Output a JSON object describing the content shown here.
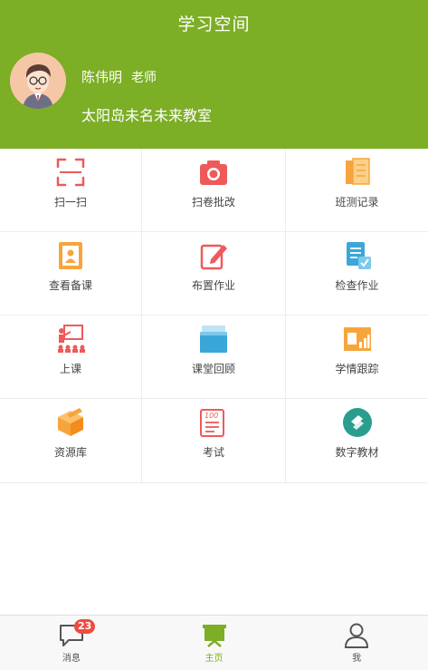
{
  "header": {
    "title": "学习空间",
    "teacher_name": "陈伟明",
    "teacher_role": "老师",
    "classroom": "太阳岛未名未来教室"
  },
  "menu": [
    {
      "label": "扫一扫",
      "icon": "scan-icon"
    },
    {
      "label": "扫卷批改",
      "icon": "camera-icon"
    },
    {
      "label": "班测记录",
      "icon": "test-records-icon"
    },
    {
      "label": "查看备课",
      "icon": "lesson-prep-icon"
    },
    {
      "label": "布置作业",
      "icon": "assign-homework-icon"
    },
    {
      "label": "检查作业",
      "icon": "check-homework-icon"
    },
    {
      "label": "上课",
      "icon": "teaching-icon"
    },
    {
      "label": "课堂回顾",
      "icon": "classroom-review-icon"
    },
    {
      "label": "学情跟踪",
      "icon": "learning-tracking-icon"
    },
    {
      "label": "资源库",
      "icon": "resource-library-icon"
    },
    {
      "label": "考试",
      "icon": "exam-icon"
    },
    {
      "label": "数字教材",
      "icon": "digital-textbook-icon"
    }
  ],
  "tabbar": {
    "messages": {
      "label": "消息",
      "badge": "23",
      "icon": "message-icon"
    },
    "home": {
      "label": "主页",
      "icon": "home-board-icon"
    },
    "me": {
      "label": "我",
      "icon": "user-icon"
    }
  },
  "colors": {
    "brand_green": "#7cae26",
    "badge_red": "#ef4b3e"
  }
}
